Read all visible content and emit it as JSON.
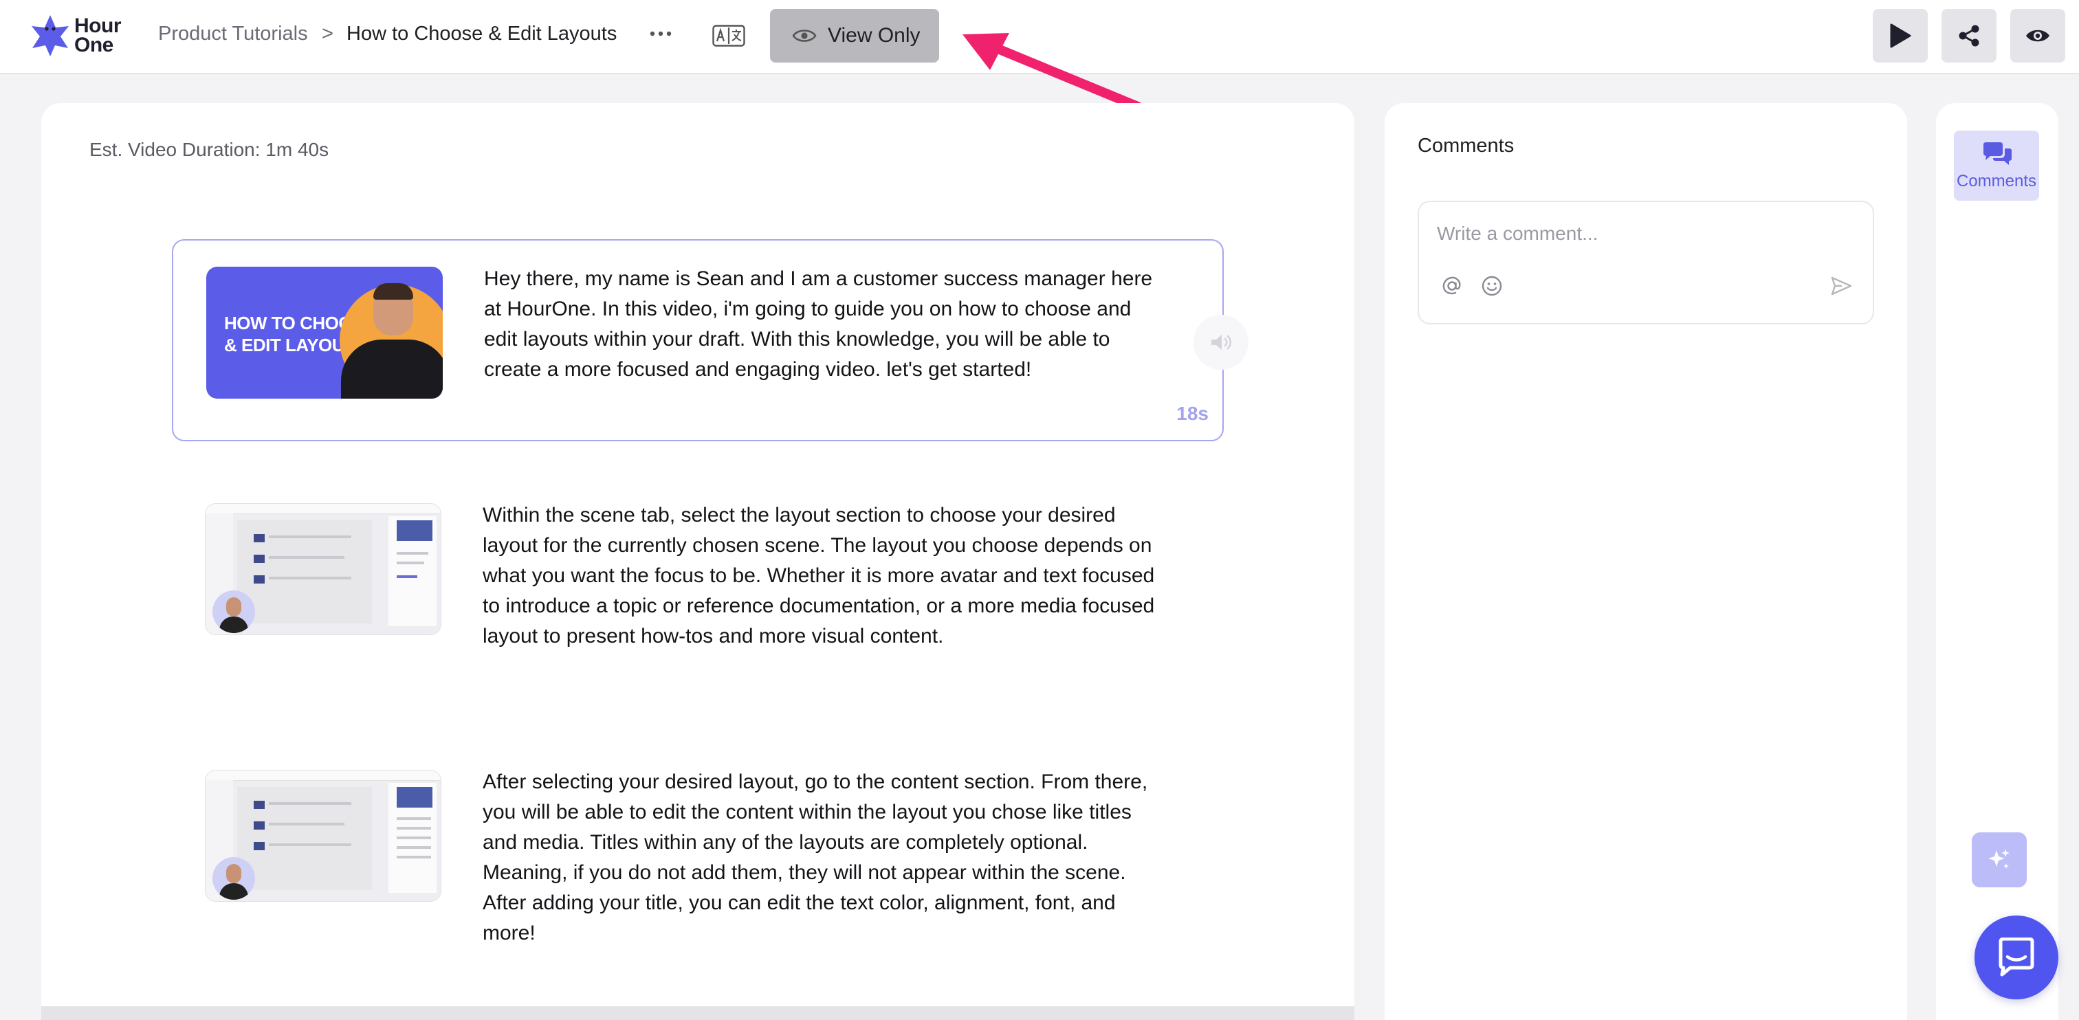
{
  "app": {
    "logo_text_line1": "Hour",
    "logo_text_line2": "One",
    "brand_color": "#5b5ce8"
  },
  "header": {
    "breadcrumb_root": "Product Tutorials",
    "breadcrumb_separator": ">",
    "breadcrumb_current": "How to Choose & Edit Layouts",
    "more_label": "•••",
    "view_only_label": "View Only",
    "right_buttons": [
      "play-icon",
      "share-icon",
      "eye-icon"
    ]
  },
  "annotation": {
    "arrow_color": "#f0226e"
  },
  "main": {
    "duration_label": "Est. Video Duration: 1m 40s",
    "scenes": [
      {
        "thumb_title_line1": "HOW TO CHOOSE",
        "thumb_title_line2": "& EDIT LAYOUTS",
        "text": "Hey there, my name is Sean and I am a customer success manager here at HourOne. In this video, i'm going to guide you on how to choose and edit layouts within your draft. With this knowledge, you will be able to create a more focused and engaging video. let's get started!",
        "duration": "18s",
        "selected": true
      },
      {
        "text": "Within the scene tab, select the layout section to choose your desired layout for the currently chosen scene. The layout you choose depends on what you want the focus to be. Whether it is more avatar and text focused to introduce a topic or reference documentation, or a more media focused layout to present how-tos and more visual content.",
        "selected": false
      },
      {
        "text": "After selecting your desired layout, go to the content section. From there, you will be able to edit the content within the layout you chose like titles and media. Titles within any of the layouts are completely optional. Meaning, if you do not add them, they will not appear within the scene. After adding your title, you can edit the text color, alignment, font, and more!",
        "selected": false
      }
    ]
  },
  "comments": {
    "title": "Comments",
    "placeholder": "Write a comment...",
    "value": ""
  },
  "rail": {
    "comments_label": "Comments"
  }
}
